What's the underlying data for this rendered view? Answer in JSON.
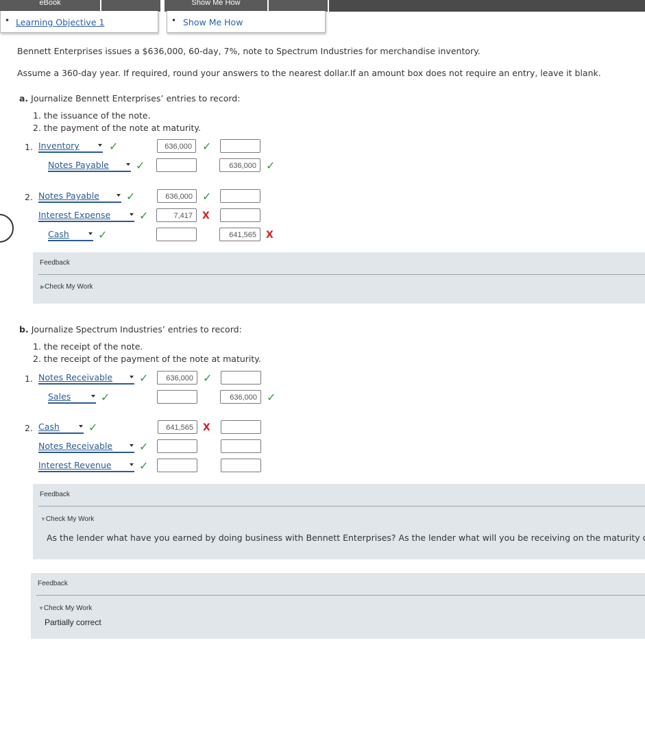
{
  "topbar": {
    "ebook_label": "eBook",
    "show_me_how_label": "Show Me How"
  },
  "popups": {
    "learning_objective": "Learning Objective 1",
    "show_me_how": "Show Me How"
  },
  "problem": {
    "statement": "Bennett Enterprises issues a $636,000, 60-day, 7%, note to Spectrum Industries for merchandise inventory.",
    "instructions": "Assume a 360-day year. If required, round your answers to the nearest dollar.If an amount box does not require an entry, leave it blank."
  },
  "part_a": {
    "letter": "a.",
    "heading": "Journalize Bennett Enterprises’ entries to record:",
    "items": [
      "1. the issuance of the note.",
      "2. the payment of the note at maturity."
    ],
    "entry1_num": "1.",
    "entry2_num": "2.",
    "rows": [
      {
        "account": "Inventory",
        "debit": "636,000",
        "credit": ""
      },
      {
        "account": "Notes Payable",
        "debit": "",
        "credit": "636,000"
      },
      {
        "account": "Notes Payable",
        "debit": "636,000",
        "credit": ""
      },
      {
        "account": "Interest Expense",
        "debit": "7,417",
        "credit": ""
      },
      {
        "account": "Cash",
        "debit": "",
        "credit": "641,565"
      }
    ],
    "feedback": {
      "header": "Feedback",
      "check_label": "Check My Work"
    }
  },
  "part_b": {
    "letter": "b.",
    "heading": "Journalize Spectrum Industries’ entries to record:",
    "items": [
      "1. the receipt of the note.",
      "2. the receipt of the payment of the note at maturity."
    ],
    "entry1_num": "1.",
    "entry2_num": "2.",
    "rows": [
      {
        "account": "Notes Receivable",
        "debit": "636,000",
        "credit": ""
      },
      {
        "account": "Sales",
        "debit": "",
        "credit": "636,000"
      },
      {
        "account": "Cash",
        "debit": "641,565",
        "credit": ""
      },
      {
        "account": "Notes Receivable",
        "debit": "",
        "credit": ""
      },
      {
        "account": "Interest Revenue",
        "debit": "",
        "credit": ""
      }
    ],
    "feedback": {
      "header": "Feedback",
      "check_label": "Check My Work",
      "hint": "As the lender what have you earned by doing business with Bennett Enterprises? As the lender what will you be receiving on the maturity date?"
    }
  },
  "overall_feedback": {
    "header": "Feedback",
    "check_label": "Check My Work",
    "result": "Partially correct"
  },
  "marks": {
    "correct": "✓",
    "incorrect": "X",
    "collapsed": "▶",
    "expanded": "▼",
    "bullet": "•"
  },
  "colors": {
    "link": "#2a5fa8",
    "correct": "#2e9a3a",
    "incorrect": "#d62020",
    "feedback_bg": "#e0e6ea"
  }
}
